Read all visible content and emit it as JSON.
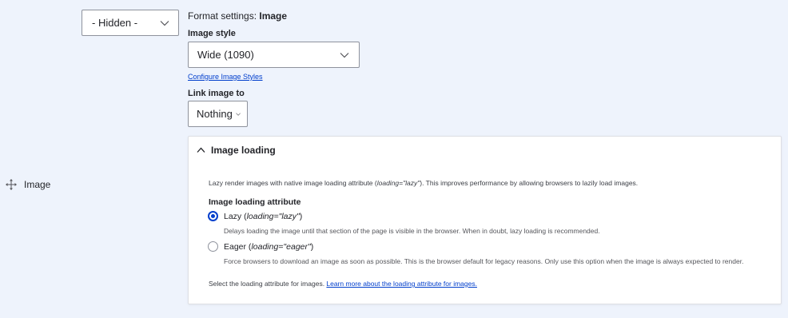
{
  "field": {
    "name": "Image",
    "icon": "drag-handle-icon"
  },
  "region_select": {
    "value": "- Hidden -"
  },
  "format": {
    "prefix": "Format settings: ",
    "name": "Image"
  },
  "image_style": {
    "label": "Image style",
    "value": "Wide (1090)",
    "configure_link": "Configure Image Styles"
  },
  "link_image": {
    "label": "Link image to",
    "value": "Nothing"
  },
  "image_loading": {
    "summary": "Image loading",
    "description_pre": "Lazy render images with native image loading attribute (",
    "description_code": "loading=\"lazy\"",
    "description_post": "). This improves performance by allowing browsers to lazily load images.",
    "attribute_label": "Image loading attribute",
    "options": [
      {
        "label": "Lazy (",
        "code": "loading=\"lazy\"",
        "close": ")",
        "checked": true,
        "help": "Delays loading the image until that section of the page is visible in the browser. When in doubt, lazy loading is recommended."
      },
      {
        "label": "Eager (",
        "code": "loading=\"eager\"",
        "close": ")",
        "checked": false,
        "help": "Force browsers to download an image as soon as possible. This is the browser default for legacy reasons. Only use this option when the image is always expected to render."
      }
    ],
    "footer_text": "Select the loading attribute for images. ",
    "footer_link": "Learn more about the loading attribute for images."
  },
  "colors": {
    "background": "#eef3fc",
    "accent": "#003ecc",
    "border": "#8e929c"
  }
}
